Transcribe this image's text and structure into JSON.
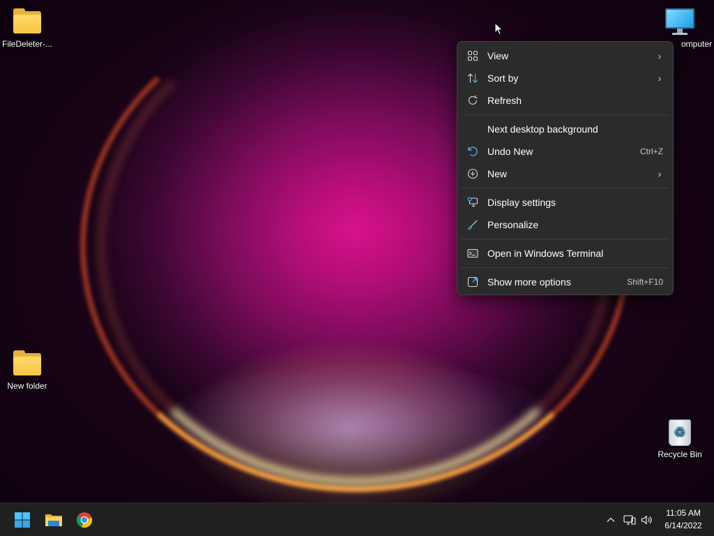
{
  "desktop": {
    "icons": [
      {
        "name": "FileDeleter-...",
        "kind": "folder"
      },
      {
        "name": "New folder",
        "kind": "folder"
      },
      {
        "name": "omputer",
        "kind": "this-pc"
      },
      {
        "name": "Recycle Bin",
        "kind": "recycle-bin"
      }
    ]
  },
  "context_menu": {
    "items": [
      {
        "label": "View",
        "icon": "grid-view-icon",
        "submenu": true
      },
      {
        "label": "Sort by",
        "icon": "sort-arrows-icon",
        "submenu": true
      },
      {
        "label": "Refresh",
        "icon": "refresh-icon"
      },
      {
        "label": "Next desktop background",
        "icon": ""
      },
      {
        "label": "Undo New",
        "icon": "undo-icon",
        "shortcut": "Ctrl+Z"
      },
      {
        "label": "New",
        "icon": "plus-circle-icon",
        "submenu": true
      },
      {
        "label": "Display settings",
        "icon": "display-settings-icon"
      },
      {
        "label": "Personalize",
        "icon": "brush-icon"
      },
      {
        "label": "Open in Windows Terminal",
        "icon": "terminal-icon"
      },
      {
        "label": "Show more options",
        "icon": "expand-options-icon",
        "shortcut": "Shift+F10"
      }
    ]
  },
  "taskbar": {
    "apps": [
      "windows-start-icon",
      "file-explorer-icon",
      "chrome-icon"
    ],
    "tray_icons": [
      "chevron-up-icon",
      "network-icon",
      "volume-icon"
    ],
    "clock": {
      "time": "11:05 AM",
      "date": "6/14/2022"
    }
  },
  "colors": {
    "menu_bg": "#2b2b2b",
    "taskbar_bg": "#202020",
    "accent_blue": "#4cc2ff"
  }
}
